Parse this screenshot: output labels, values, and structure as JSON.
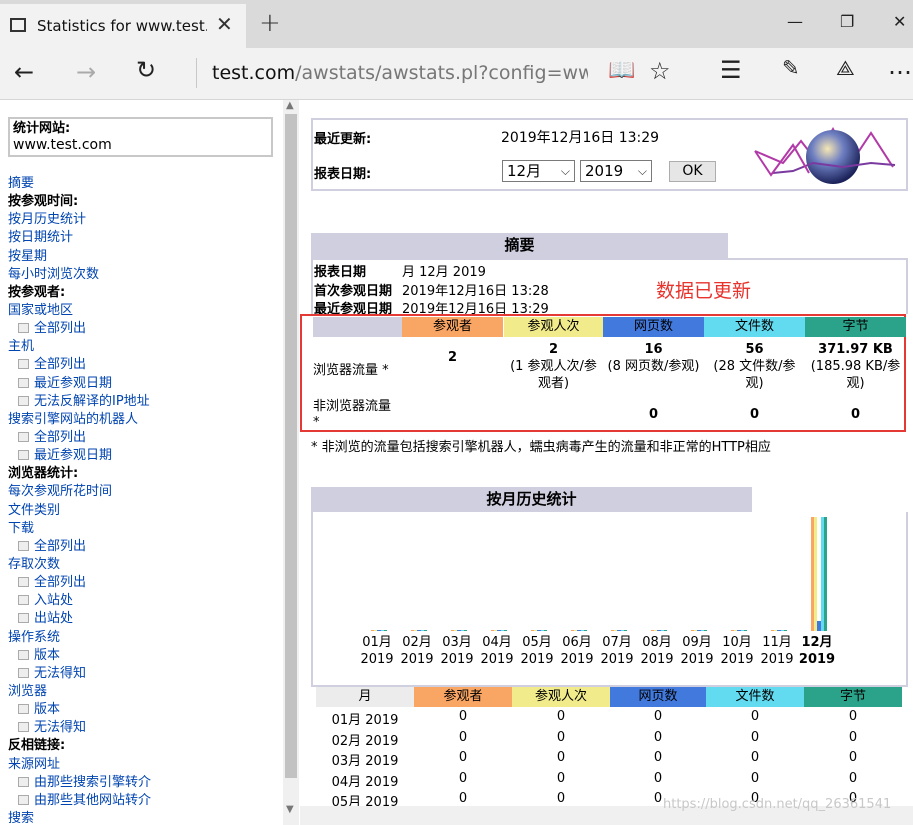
{
  "browser": {
    "tab_title": "Statistics for www.test.co",
    "url_host": "test.com",
    "url_path": "/awstats/awstats.pl?config=www.test"
  },
  "sidebar": {
    "site_label": "统计网站:",
    "site_value": "www.test.com",
    "items": [
      {
        "text": "摘要",
        "kind": "link"
      },
      {
        "text": "按参观时间:",
        "kind": "head"
      },
      {
        "text": "按月历史统计",
        "kind": "link"
      },
      {
        "text": "按日期统计",
        "kind": "link"
      },
      {
        "text": "按星期",
        "kind": "link"
      },
      {
        "text": "每小时浏览次数",
        "kind": "link"
      },
      {
        "text": "按参观者:",
        "kind": "head"
      },
      {
        "text": "国家或地区",
        "kind": "link"
      },
      {
        "text": "全部列出",
        "kind": "sub"
      },
      {
        "text": "主机",
        "kind": "link"
      },
      {
        "text": "全部列出",
        "kind": "sub"
      },
      {
        "text": "最近参观日期",
        "kind": "sub"
      },
      {
        "text": "无法反解译的IP地址",
        "kind": "sub"
      },
      {
        "text": "搜索引擎网站的机器人",
        "kind": "link"
      },
      {
        "text": "全部列出",
        "kind": "sub"
      },
      {
        "text": "最近参观日期",
        "kind": "sub"
      },
      {
        "text": "浏览器统计:",
        "kind": "head"
      },
      {
        "text": "每次参观所花时间",
        "kind": "link"
      },
      {
        "text": "文件类别",
        "kind": "link"
      },
      {
        "text": "下载",
        "kind": "link"
      },
      {
        "text": "全部列出",
        "kind": "sub"
      },
      {
        "text": "存取次数",
        "kind": "link"
      },
      {
        "text": "全部列出",
        "kind": "sub"
      },
      {
        "text": "入站处",
        "kind": "sub"
      },
      {
        "text": "出站处",
        "kind": "sub"
      },
      {
        "text": "操作系统",
        "kind": "link"
      },
      {
        "text": "版本",
        "kind": "sub"
      },
      {
        "text": "无法得知",
        "kind": "sub"
      },
      {
        "text": "浏览器",
        "kind": "link"
      },
      {
        "text": "版本",
        "kind": "sub"
      },
      {
        "text": "无法得知",
        "kind": "sub"
      },
      {
        "text": "反相链接:",
        "kind": "head"
      },
      {
        "text": "来源网址",
        "kind": "link"
      },
      {
        "text": "由那些搜索引擎转介",
        "kind": "sub"
      },
      {
        "text": "由那些其他网站转介",
        "kind": "sub"
      },
      {
        "text": "搜索",
        "kind": "link"
      }
    ]
  },
  "info": {
    "last_update_label": "最近更新:",
    "last_update_value": "2019年12月16日 13:29",
    "report_date_label": "报表日期:",
    "month_select": "12月",
    "year_select": "2019",
    "ok_label": "OK"
  },
  "summary": {
    "title": "摘要",
    "period_label": "报表日期",
    "period_value": "月 12月 2019",
    "first_visit_label": "首次参观日期",
    "first_visit_value": "2019年12月16日 13:28",
    "last_visit_label": "最近参观日期",
    "last_visit_value": "2019年12月16日 13:29",
    "notice": "数据已更新",
    "headers": [
      "参观者",
      "参观人次",
      "网页数",
      "文件数",
      "字节"
    ],
    "header_colors": [
      "#f9a564",
      "#f1eb8b",
      "#4279dd",
      "#62daf0",
      "#2aa38a"
    ],
    "browser_traffic_label": "浏览器流量 *",
    "browser_values": [
      "2",
      "2",
      "16",
      "56",
      "371.97 KB"
    ],
    "browser_sub": [
      "",
      "(1 参观人次/参观者)",
      "(8 网页数/参观)",
      "(28 文件数/参观)",
      "(185.98 KB/参观)"
    ],
    "non_browser_label": "非浏览器流量 *",
    "non_browser_values": [
      "",
      "",
      "0",
      "0",
      "0"
    ],
    "footnote": "* 非浏览的流量包括搜索引擎机器人，蠕虫病毒产生的流量和非正常的HTTP相应"
  },
  "monthly": {
    "title": "按月历史统计",
    "months": [
      "01月",
      "02月",
      "03月",
      "04月",
      "05月",
      "06月",
      "07月",
      "08月",
      "09月",
      "10月",
      "11月",
      "12月"
    ],
    "year": "2019",
    "table_headers": [
      "月",
      "参观者",
      "参观人次",
      "网页数",
      "文件数",
      "字节"
    ],
    "rows": [
      [
        "01月 2019",
        "0",
        "0",
        "0",
        "0",
        "0"
      ],
      [
        "02月 2019",
        "0",
        "0",
        "0",
        "0",
        "0"
      ],
      [
        "03月 2019",
        "0",
        "0",
        "0",
        "0",
        "0"
      ],
      [
        "04月 2019",
        "0",
        "0",
        "0",
        "0",
        "0"
      ],
      [
        "05月 2019",
        "0",
        "0",
        "0",
        "0",
        "0"
      ]
    ]
  },
  "chart_data": {
    "type": "bar",
    "categories": [
      "01月 2019",
      "02月 2019",
      "03月 2019",
      "04月 2019",
      "05月 2019",
      "06月 2019",
      "07月 2019",
      "08月 2019",
      "09月 2019",
      "10月 2019",
      "11月 2019",
      "12月 2019"
    ],
    "series": [
      {
        "name": "参观者",
        "color": "#f9a564",
        "values": [
          0,
          0,
          0,
          0,
          0,
          0,
          0,
          0,
          0,
          0,
          0,
          2
        ]
      },
      {
        "name": "参观人次",
        "color": "#f1eb8b",
        "values": [
          0,
          0,
          0,
          0,
          0,
          0,
          0,
          0,
          0,
          0,
          0,
          2
        ]
      },
      {
        "name": "网页数",
        "color": "#4279dd",
        "values": [
          0,
          0,
          0,
          0,
          0,
          0,
          0,
          0,
          0,
          0,
          0,
          16
        ]
      },
      {
        "name": "文件数",
        "color": "#62daf0",
        "values": [
          0,
          0,
          0,
          0,
          0,
          0,
          0,
          0,
          0,
          0,
          0,
          56
        ]
      },
      {
        "name": "字节",
        "color": "#2aa38a",
        "values": [
          0,
          0,
          0,
          0,
          0,
          0,
          0,
          0,
          0,
          0,
          0,
          371.97
        ]
      }
    ]
  },
  "watermark": "https://blog.csdn.net/qq_26361541"
}
